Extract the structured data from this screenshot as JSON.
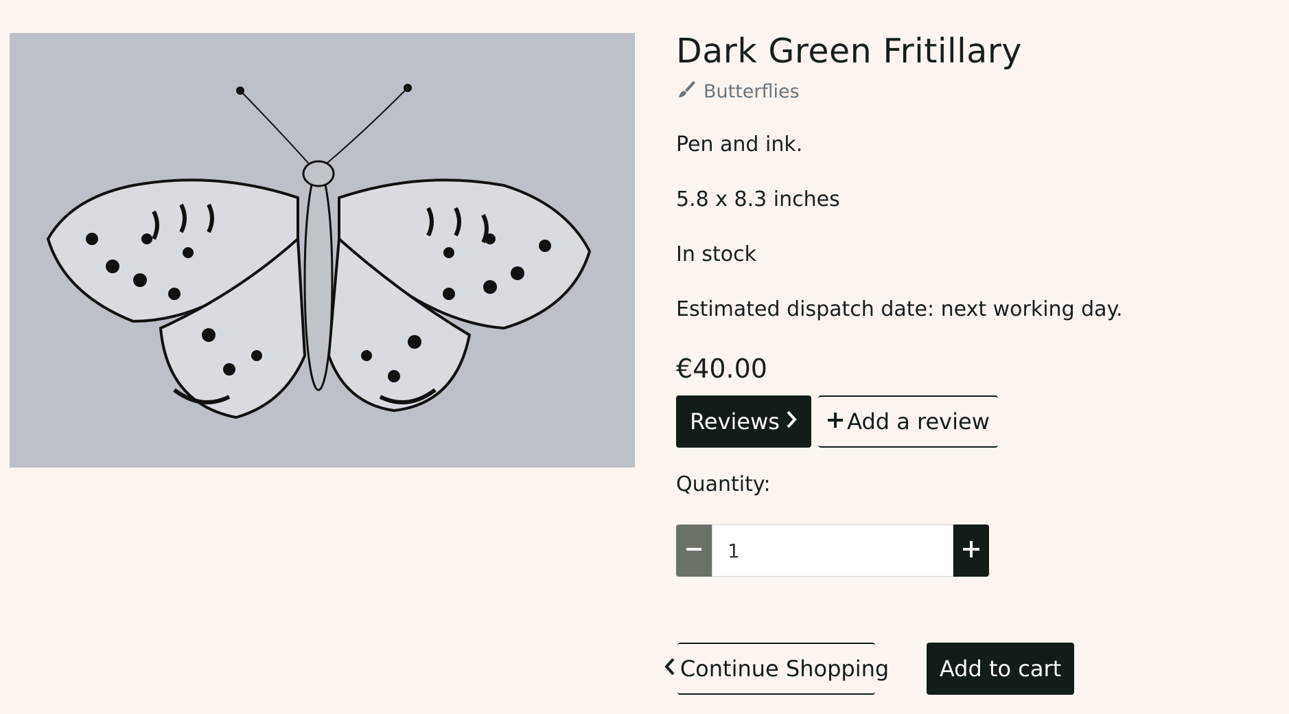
{
  "product": {
    "image_alt": "Pen and ink drawing of a Dark Green Fritillary butterfly",
    "title": "Dark Green Fritillary",
    "category": "Butterflies",
    "medium": "Pen and ink.",
    "size": "5.8 x 8.3 inches",
    "stock": "In stock",
    "dispatch": "Estimated dispatch date: next working day.",
    "price": "€40.00"
  },
  "actions": {
    "reviews_label": "Reviews",
    "add_review_label": "Add a review",
    "continue_label": "Continue Shopping",
    "add_to_cart_label": "Add to cart"
  },
  "quantity": {
    "label": "Quantity:",
    "value": "1"
  },
  "icons": {
    "category": "paintbrush-icon",
    "reviews": "chevron-right-icon",
    "add_review": "plus-icon",
    "decrement": "minus-icon",
    "increment": "plus-icon",
    "continue": "chevron-left-icon"
  },
  "colors": {
    "background": "#fcf5f0",
    "dark": "#121c19",
    "muted": "#6c757d",
    "minus_button": "#6b7368"
  }
}
